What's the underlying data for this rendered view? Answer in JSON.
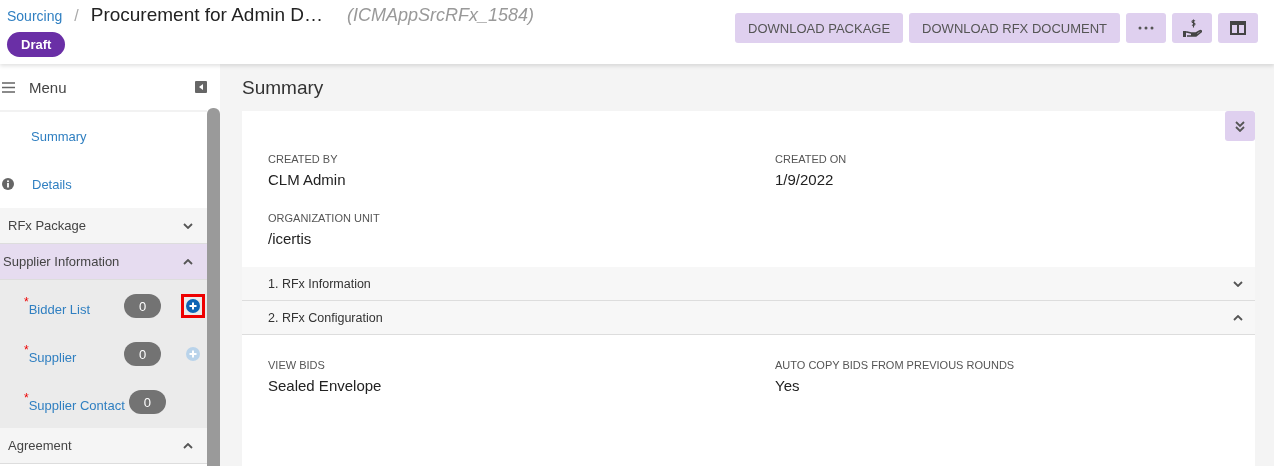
{
  "header": {
    "breadcrumb": "Sourcing",
    "separator": "/",
    "title": "Procurement for Admin D…",
    "record_id": "(ICMAppSrcRFx_1584)",
    "status": "Draft",
    "actions": [
      {
        "kind": "text",
        "label": "DOWNLOAD PACKAGE"
      },
      {
        "kind": "text",
        "label": "DOWNLOAD RFX DOCUMENT"
      },
      {
        "kind": "more"
      },
      {
        "kind": "hand-dollar"
      },
      {
        "kind": "columns"
      }
    ]
  },
  "sidebar": {
    "title": "Menu",
    "links": [
      {
        "label": "Summary",
        "icon": false
      },
      {
        "label": "Details",
        "icon": true
      }
    ],
    "sections": [
      {
        "label": "RFx Package",
        "expanded": false,
        "selected": false
      },
      {
        "label": "Supplier Information",
        "expanded": true,
        "selected": true,
        "children": [
          {
            "required_mark": "*",
            "label": "Bidder List",
            "count": "0",
            "add": true,
            "disabled": false,
            "highlighted": true
          },
          {
            "required_mark": "*",
            "label": "Supplier",
            "count": "0",
            "add": true,
            "disabled": true,
            "highlighted": false
          },
          {
            "required_mark": "*",
            "label": "Supplier Contact",
            "count": "0",
            "add": false
          }
        ]
      },
      {
        "label": "Agreement",
        "expanded": true,
        "selected": false
      }
    ]
  },
  "main": {
    "title": "Summary",
    "fields": [
      {
        "label": "CREATED BY",
        "value": "CLM Admin"
      },
      {
        "label": "CREATED ON",
        "value": "1/9/2022"
      },
      {
        "label": "ORGANIZATION UNIT",
        "value": "/icertis"
      }
    ],
    "sections": [
      {
        "label": "1. RFx Information",
        "expanded": false
      },
      {
        "label": "2. RFx Configuration",
        "expanded": true,
        "fields": [
          {
            "label": "VIEW BIDS",
            "value": "Sealed Envelope"
          },
          {
            "label": "AUTO COPY BIDS FROM PREVIOUS ROUNDS",
            "value": "Yes"
          }
        ]
      }
    ]
  }
}
